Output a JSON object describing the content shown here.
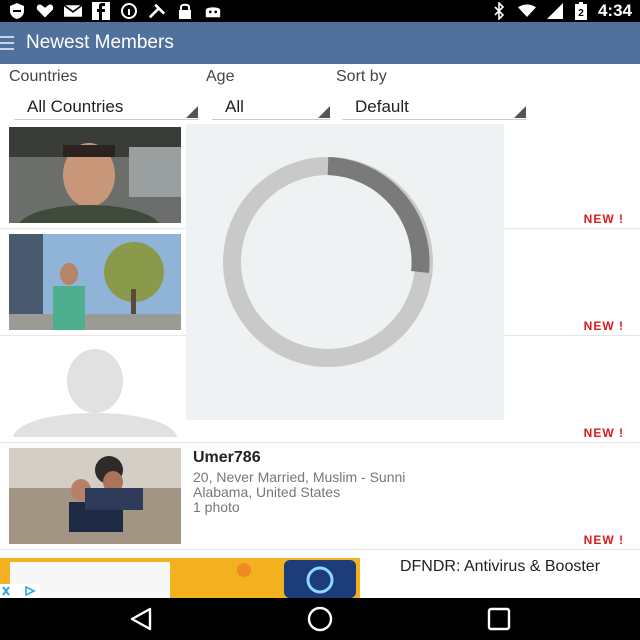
{
  "status_bar": {
    "time": "4:34",
    "left_icons": [
      "shield-icon",
      "heart-icon",
      "mail-icon",
      "facebook-icon",
      "info-icon",
      "tools-icon",
      "lock-icon",
      "android-icon"
    ],
    "right_icons": [
      "bluetooth-icon",
      "wifi-icon",
      "signal-icon",
      "battery-icon"
    ],
    "battery_level": "2"
  },
  "app_bar": {
    "title": "Newest Members",
    "color": "#50719b"
  },
  "filters": {
    "countries": {
      "label": "Countries",
      "value": "All Countries"
    },
    "age": {
      "label": "Age",
      "value": "All"
    },
    "sort_by": {
      "label": "Sort by",
      "value": "Default"
    }
  },
  "members": [
    {
      "badge": "NEW !"
    },
    {
      "badge": "NEW !"
    },
    {
      "badge": "NEW !"
    },
    {
      "name": "Umer786",
      "details": "20, Never Married, Muslim - Sunni",
      "location": "Alabama, United States",
      "photos": "1 photo",
      "badge": "NEW !"
    }
  ],
  "ad": {
    "title": "DFNDR: Antivirus & Booster"
  },
  "colors": {
    "accent": "#50719b",
    "new_badge": "#d91c1c"
  }
}
